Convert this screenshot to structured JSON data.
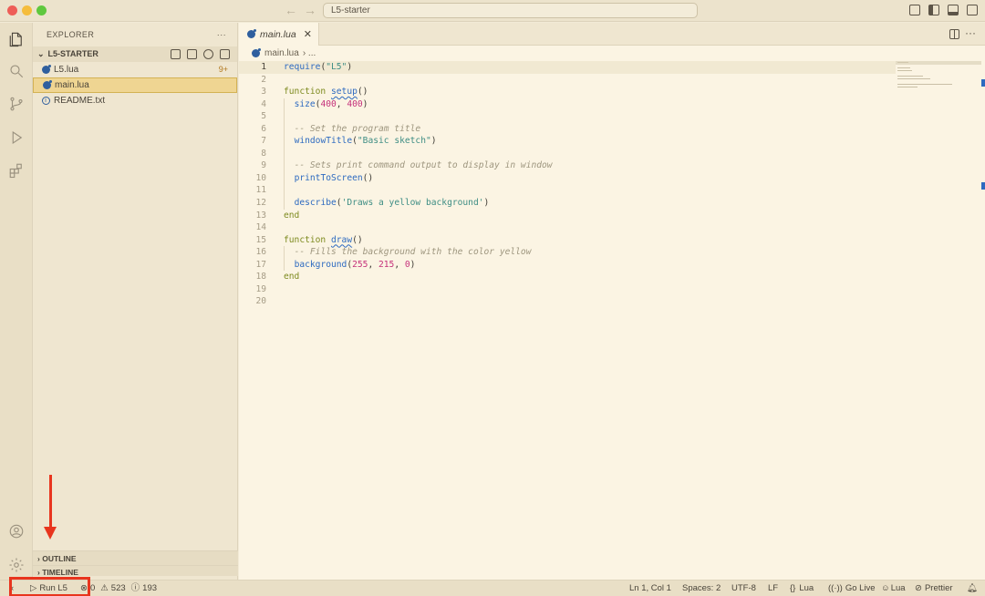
{
  "window": {
    "title": "L5-starter"
  },
  "sidebar": {
    "header": "EXPLORER",
    "more": "···",
    "folder": "L5-STARTER",
    "files": [
      {
        "name": "L5.lua",
        "badge": "9+"
      },
      {
        "name": "main.lua",
        "badge": ""
      },
      {
        "name": "README.txt",
        "badge": ""
      }
    ],
    "outline": "OUTLINE",
    "timeline": "TIMELINE"
  },
  "editor": {
    "tab": "main.lua",
    "breadcrumb_file": "main.lua",
    "breadcrumb_rest": "›  ...",
    "line_numbers": [
      "1",
      "2",
      "3",
      "4",
      "5",
      "6",
      "7",
      "8",
      "9",
      "10",
      "11",
      "12",
      "13",
      "14",
      "15",
      "16",
      "17",
      "18",
      "19",
      "20"
    ]
  },
  "statusbar": {
    "run": "Run L5",
    "errors": "0",
    "warnings": "523",
    "infos": "193",
    "position": "Ln 1, Col 1",
    "spaces": "Spaces: 2",
    "encoding": "UTF-8",
    "eol": "LF",
    "language": "Lua",
    "golive": "Go Live",
    "lua_ext": "Lua",
    "prettier": "Prettier"
  },
  "icons": {
    "explorer": "files-icon",
    "search": "search-icon",
    "scm": "source-control-icon",
    "debug": "run-debug-icon",
    "extensions": "extensions-icon",
    "account": "account-icon",
    "settings": "gear-icon"
  },
  "annotation_color": "#e8351e"
}
